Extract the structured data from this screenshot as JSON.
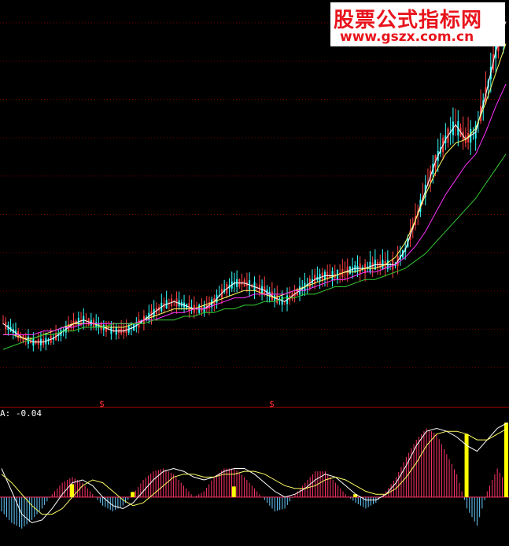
{
  "watermark": {
    "title": "股票公式指标网",
    "url": "www.gszx.com.cn"
  },
  "indicator": {
    "label": "A: -0.04"
  },
  "markers": [
    "$",
    "$"
  ],
  "colors": {
    "background": "#000000",
    "gridline": "#7a0000",
    "separator": "#a00000",
    "ma_short": "#ffffff",
    "ma_mid": "#ffff66",
    "ma_long": "#ff33ff",
    "ma_green": "#33cc33",
    "candle_up": "#ff4040",
    "candle_down": "#33ffff",
    "hist_pos": "#ff3366",
    "hist_neg": "#66ccff",
    "signal_bar": "#ffff00",
    "watermark_text": "#e8141c"
  },
  "chart_data": [
    {
      "type": "candlestick",
      "title": "",
      "grid": true,
      "series": [
        {
          "values": [
            2.0,
            1.8,
            1.6,
            1.5,
            1.5,
            1.6,
            1.8,
            2.0,
            2.1,
            2.0,
            1.9,
            1.8,
            1.8,
            1.9,
            2.1,
            2.3,
            2.5,
            2.6,
            2.5,
            2.4,
            2.4,
            2.6,
            2.9,
            3.1,
            3.1,
            3.0,
            2.9,
            2.7,
            2.6,
            2.8,
            3.0,
            3.2,
            3.3,
            3.3,
            3.4,
            3.5,
            3.5,
            3.6,
            3.6,
            3.6,
            4.0,
            4.8,
            5.6,
            6.4,
            7.0,
            7.4,
            7.0,
            7.2,
            8.2,
            9.4,
            10.2
          ]
        },
        {
          "values": [
            1.7,
            1.7,
            1.6,
            1.6,
            1.7,
            1.8,
            1.9,
            2.0,
            2.0,
            2.0,
            1.9,
            1.9,
            1.9,
            2.0,
            2.1,
            2.2,
            2.3,
            2.4,
            2.4,
            2.4,
            2.5,
            2.6,
            2.7,
            2.8,
            2.9,
            2.9,
            2.8,
            2.7,
            2.8,
            2.9,
            3.0,
            3.1,
            3.2,
            3.3,
            3.4,
            3.4,
            3.5,
            3.5,
            3.6,
            3.8,
            4.2,
            4.8,
            5.5,
            6.1,
            6.6,
            6.9,
            7.0,
            7.3,
            8.0,
            8.8,
            9.6
          ]
        },
        {
          "values": [
            1.7,
            1.7,
            1.7,
            1.7,
            1.8,
            1.8,
            1.9,
            1.9,
            2.0,
            2.0,
            2.0,
            2.0,
            2.0,
            2.0,
            2.1,
            2.1,
            2.2,
            2.3,
            2.3,
            2.4,
            2.4,
            2.5,
            2.6,
            2.7,
            2.7,
            2.8,
            2.8,
            2.8,
            2.8,
            2.9,
            2.9,
            3.0,
            3.1,
            3.2,
            3.2,
            3.3,
            3.4,
            3.4,
            3.5,
            3.6,
            3.8,
            4.1,
            4.5,
            5.0,
            5.5,
            5.9,
            6.3,
            6.6,
            7.2,
            7.9,
            8.5
          ]
        },
        {
          "values": [
            1.3,
            1.4,
            1.5,
            1.6,
            1.7,
            1.7,
            1.8,
            1.8,
            1.9,
            1.9,
            1.9,
            2.0,
            2.0,
            2.0,
            2.0,
            2.1,
            2.1,
            2.1,
            2.2,
            2.2,
            2.3,
            2.3,
            2.4,
            2.4,
            2.5,
            2.5,
            2.6,
            2.6,
            2.7,
            2.7,
            2.8,
            2.8,
            2.9,
            3.0,
            3.0,
            3.1,
            3.2,
            3.2,
            3.3,
            3.4,
            3.5,
            3.7,
            3.9,
            4.2,
            4.5,
            4.8,
            5.1,
            5.4,
            5.8,
            6.2,
            6.6
          ]
        }
      ],
      "ylim": [
        0,
        10.4
      ]
    },
    {
      "type": "bar",
      "series": [
        {
          "values": [
            -0.5,
            -0.9,
            -1.1,
            -0.8,
            -0.4,
            0.1,
            0.5,
            0.7,
            0.5,
            0.1,
            -0.3,
            -0.5,
            -0.3,
            0.1,
            0.6,
            0.9,
            1.0,
            0.8,
            0.4,
            0.0,
            0.2,
            0.7,
            1.0,
            1.0,
            0.7,
            0.3,
            -0.1,
            -0.5,
            -0.4,
            0.1,
            0.5,
            0.9,
            0.9,
            0.5,
            0.1,
            -0.2,
            -0.4,
            -0.2,
            0.2,
            0.7,
            1.4,
            2.0,
            2.4,
            2.2,
            1.5,
            0.8,
            -0.4,
            -1.0,
            0.2,
            1.0,
            0.4
          ]
        },
        {
          "values": [
            1.0,
            0.2,
            -0.6,
            -0.9,
            -0.8,
            -0.4,
            0.1,
            0.5,
            0.6,
            0.4,
            0.0,
            -0.3,
            -0.4,
            -0.2,
            0.2,
            0.6,
            0.9,
            1.0,
            0.9,
            0.7,
            0.6,
            0.7,
            0.9,
            1.0,
            1.0,
            0.8,
            0.5,
            0.2,
            0.0,
            0.1,
            0.3,
            0.6,
            0.8,
            0.7,
            0.4,
            0.1,
            -0.1,
            -0.1,
            0.1,
            0.5,
            1.1,
            1.8,
            2.3,
            2.4,
            2.3,
            2.1,
            1.8,
            1.6,
            2.0,
            2.4,
            2.6
          ]
        },
        {
          "values": [
            0.8,
            0.5,
            0.1,
            -0.3,
            -0.6,
            -0.6,
            -0.4,
            0.0,
            0.4,
            0.6,
            0.5,
            0.2,
            -0.1,
            -0.3,
            -0.2,
            0.1,
            0.4,
            0.7,
            0.8,
            0.8,
            0.7,
            0.7,
            0.8,
            0.8,
            0.9,
            0.9,
            0.8,
            0.6,
            0.4,
            0.3,
            0.3,
            0.4,
            0.6,
            0.7,
            0.6,
            0.4,
            0.2,
            0.1,
            0.1,
            0.3,
            0.7,
            1.2,
            1.8,
            2.2,
            2.3,
            2.3,
            2.2,
            2.0,
            2.0,
            2.2,
            2.4
          ]
        },
        {
          "values": [
            0,
            0,
            0,
            0,
            0,
            0,
            0,
            0.45,
            0,
            0,
            0,
            0,
            0,
            0.18,
            0,
            0,
            0,
            0,
            0,
            0,
            0,
            0,
            0,
            0.37,
            0,
            0,
            0,
            0,
            0,
            0,
            0,
            0,
            0,
            0,
            0,
            0.1,
            0,
            0,
            0,
            0,
            0,
            0,
            0,
            0,
            0,
            0,
            2.2,
            0,
            0,
            0,
            2.6
          ]
        }
      ],
      "ylim": [
        -1.6,
        2.8
      ]
    }
  ]
}
